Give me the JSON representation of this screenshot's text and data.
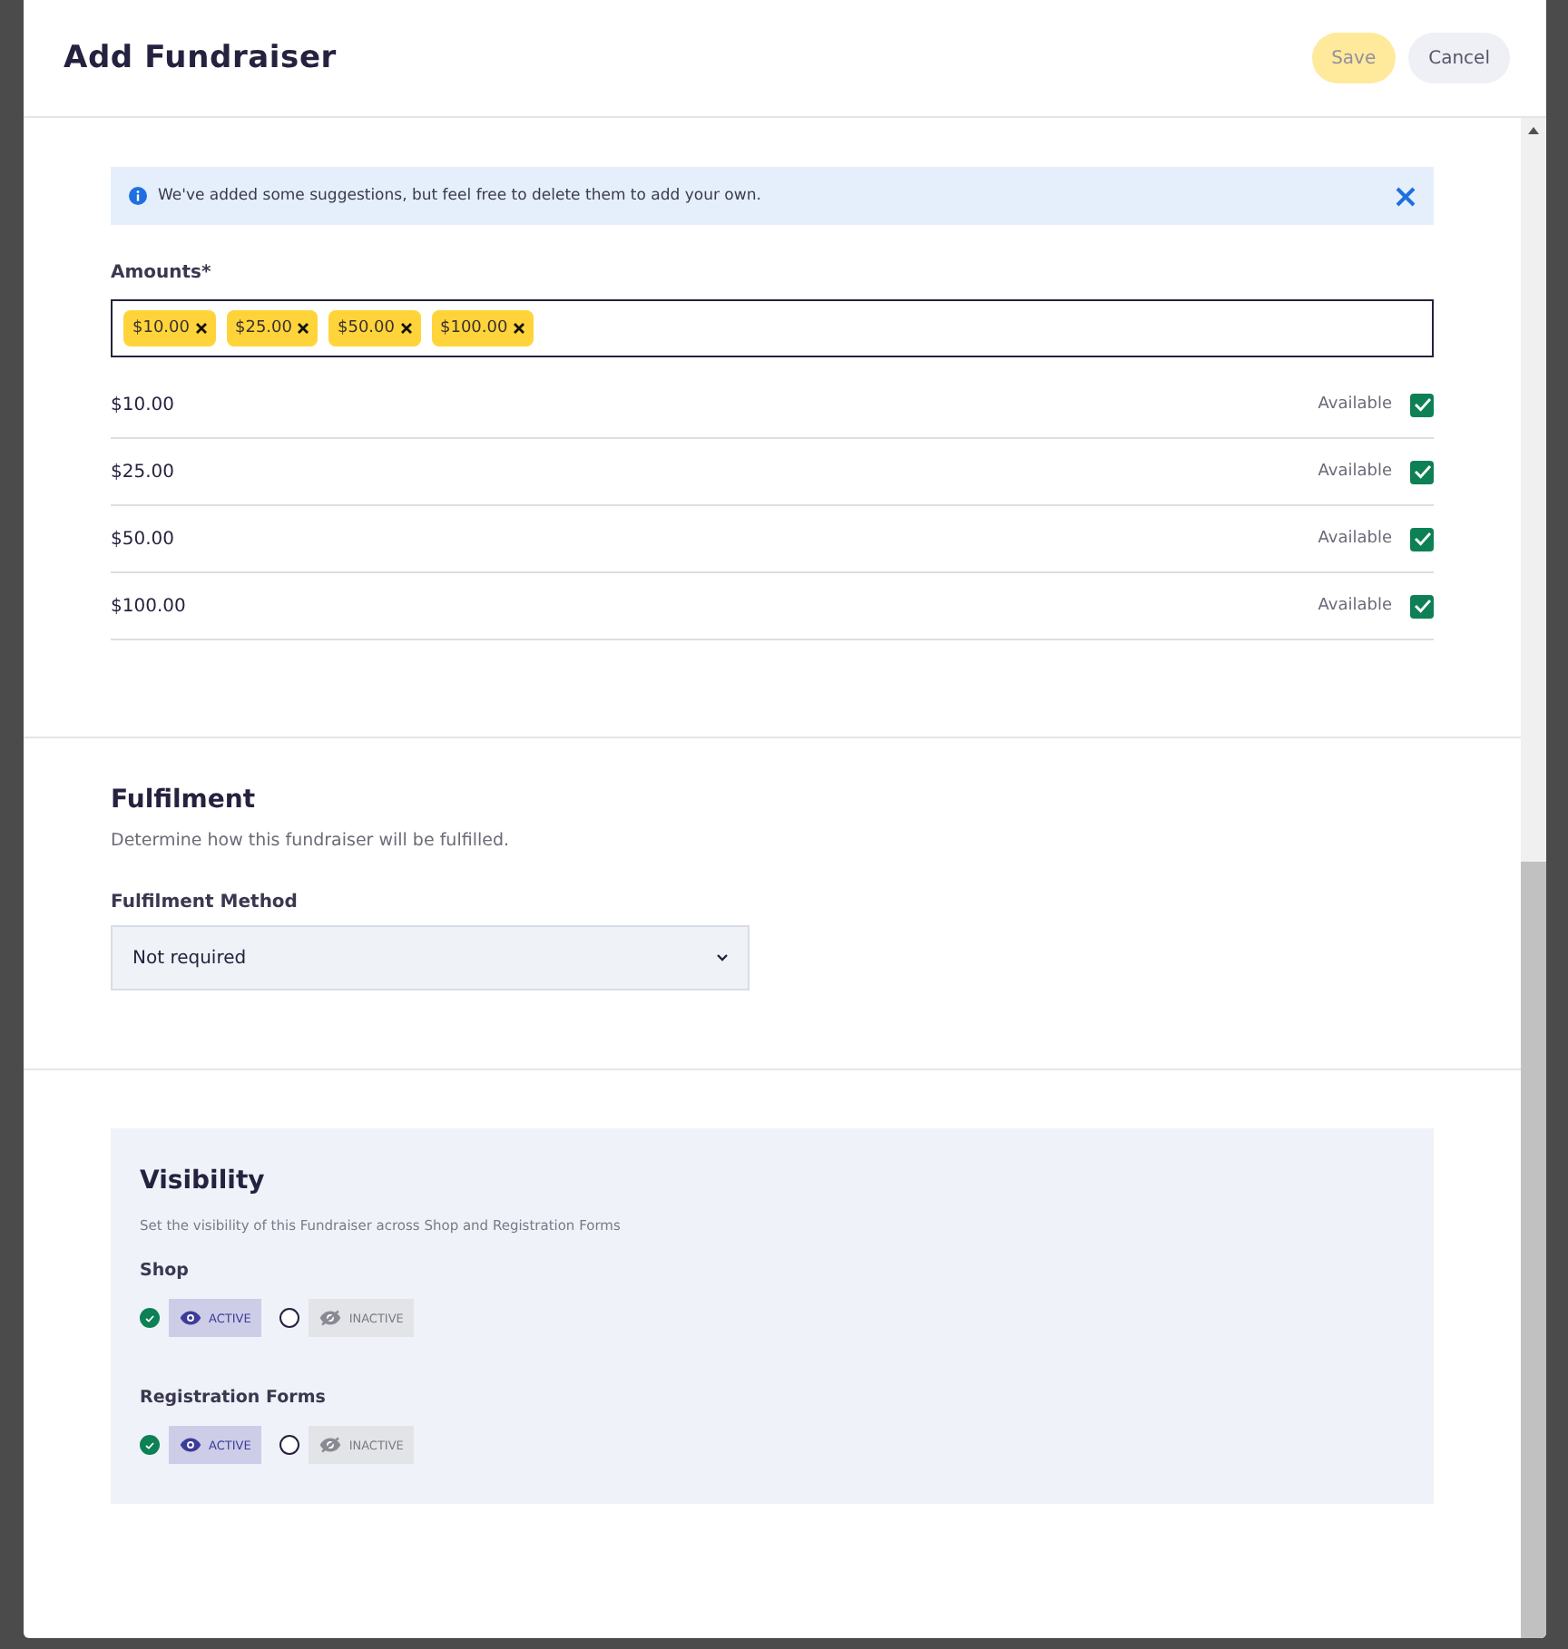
{
  "modal": {
    "title": "Add Fundraiser",
    "buttons": [
      {
        "label": "Save",
        "kind": "primary",
        "disabled": true
      },
      {
        "label": "Cancel",
        "kind": "secondary",
        "disabled": false
      }
    ]
  },
  "notice": {
    "text": "We've added some suggestions, but feel free to delete them to add your own."
  },
  "amounts": {
    "label": "Amounts*",
    "tags": [
      "$10.00",
      "$25.00",
      "$50.00",
      "$100.00"
    ],
    "rows": [
      {
        "amount": "$10.00",
        "status": "Available",
        "checked": true
      },
      {
        "amount": "$25.00",
        "status": "Available",
        "checked": true
      },
      {
        "amount": "$50.00",
        "status": "Available",
        "checked": true
      },
      {
        "amount": "$100.00",
        "status": "Available",
        "checked": true
      }
    ]
  },
  "fulfilment": {
    "title": "Fulfilment",
    "description": "Determine how this fundraiser will be fulfilled.",
    "field_label": "Fulfilment Method",
    "value": "Not required"
  },
  "visibility": {
    "title": "Visibility",
    "description": "Set the visibility of this Fundraiser across Shop and Registration Forms",
    "groups": [
      {
        "label": "Shop",
        "options": [
          {
            "label": "ACTIVE",
            "selected": true
          },
          {
            "label": "INACTIVE",
            "selected": false
          }
        ]
      },
      {
        "label": "Registration Forms",
        "options": [
          {
            "label": "ACTIVE",
            "selected": true
          },
          {
            "label": "INACTIVE",
            "selected": false
          }
        ]
      }
    ]
  }
}
